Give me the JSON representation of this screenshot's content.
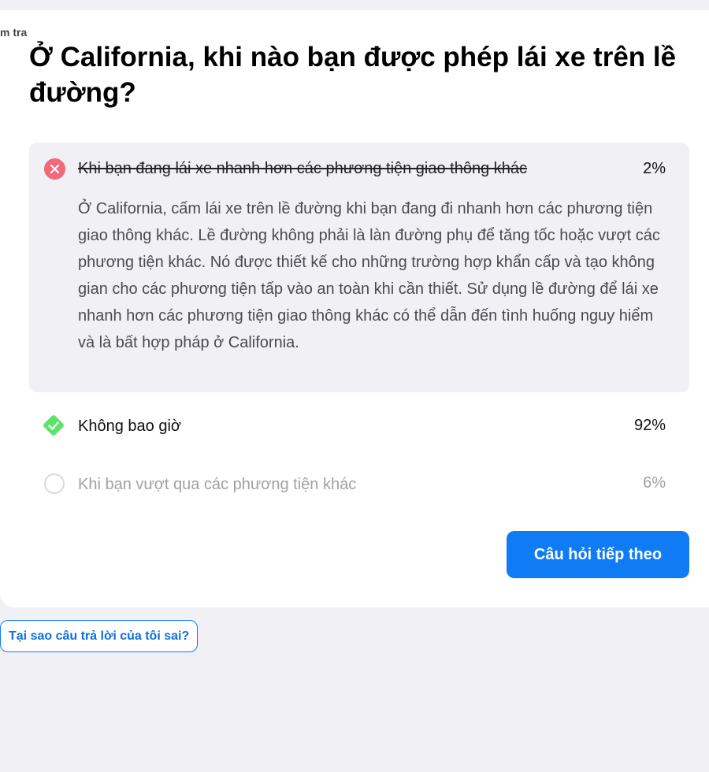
{
  "breadcrumb": "m tra",
  "question": "Ở California, khi nào bạn được phép lái xe trên lề đường?",
  "answers": [
    {
      "text": "Khi bạn đang lái xe nhanh hơn các phương tiện giao thông khác",
      "percent": "2%",
      "status": "incorrect",
      "explanation": "Ở California, cấm lái xe trên lề đường khi bạn đang đi nhanh hơn các phương tiện giao thông khác. Lề đường không phải là làn đường phụ để tăng tốc hoặc vượt các phương tiện khác. Nó được thiết kế cho những trường hợp khẩn cấp và tạo không gian cho các phương tiện tấp vào an toàn khi cần thiết. Sử dụng lề đường để lái xe nhanh hơn các phương tiện giao thông khác có thể dẫn đến tình huống nguy hiểm và là bất hợp pháp ở California."
    },
    {
      "text": "Không bao giờ",
      "percent": "92%",
      "status": "correct"
    },
    {
      "text": "Khi bạn vượt qua các phương tiện khác",
      "percent": "6%",
      "status": "unselected"
    }
  ],
  "buttons": {
    "next": "Câu hỏi tiếp theo",
    "why_wrong": "Tại sao câu trả lời của tôi sai?"
  },
  "colors": {
    "accent": "#0f7cf6",
    "incorrect": "#f06a7a",
    "correct": "#5ce36b",
    "page_bg": "#f0f0f5"
  }
}
